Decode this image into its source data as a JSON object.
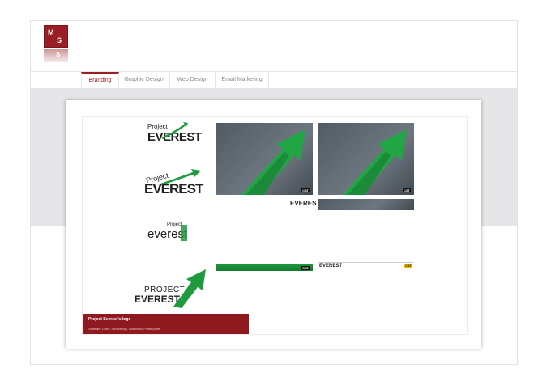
{
  "logo": {
    "mark_top": "M",
    "mark_bottom": "S"
  },
  "nav": {
    "tabs": [
      {
        "label": "Branding",
        "active": true
      },
      {
        "label": "Graphic Design",
        "active": false
      },
      {
        "label": "Web Design",
        "active": false
      },
      {
        "label": "Email Marketing",
        "active": false
      }
    ]
  },
  "project": {
    "logo_variants": [
      {
        "line1": "Project",
        "line2": "EVEREST"
      },
      {
        "line1": "Project",
        "line2": "EVEREST"
      },
      {
        "line1": "Project",
        "line2": "everest"
      },
      {
        "line1": "PROJECT",
        "line2": "EVEREST"
      }
    ],
    "cat_badge": "CAT",
    "caption_title": "Project Everest's logo",
    "caption_software": "Software Used: Photoshop, Illustrator, Powerpoint"
  },
  "colors": {
    "accent": "#9a1f24",
    "green": "#1f9a3e",
    "band": "#e6e6e8"
  }
}
